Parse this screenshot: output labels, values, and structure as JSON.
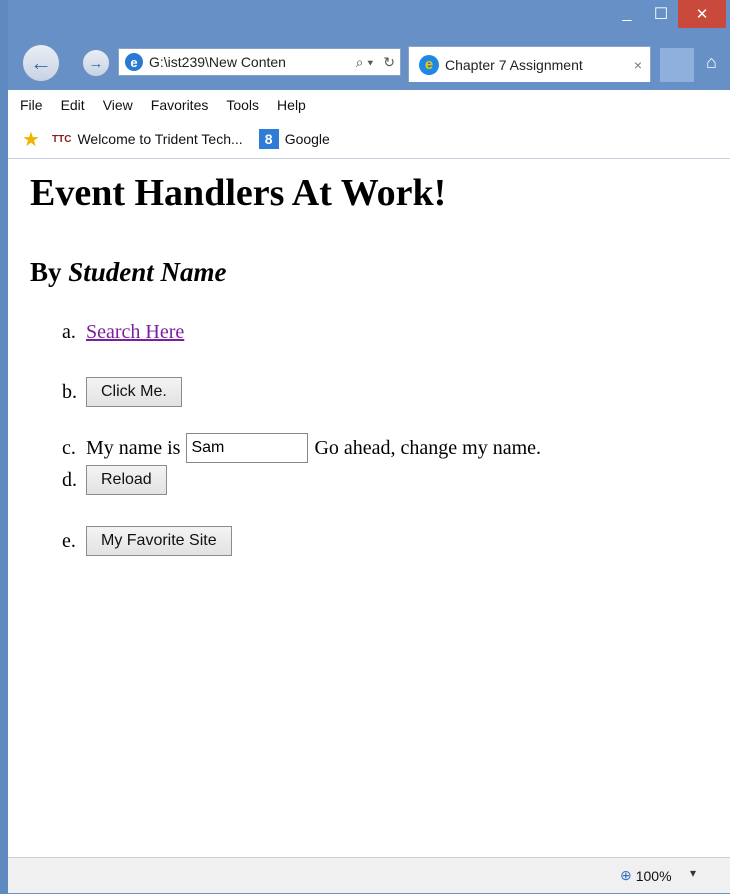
{
  "titlebar": {
    "min": "_",
    "max": "☐",
    "close": "✕"
  },
  "addressbar": {
    "url": "G:\\ist239\\New Conten",
    "search_glyph": "⌕ ▾",
    "refresh_glyph": "↻"
  },
  "tab": {
    "title": "Chapter 7 Assignment",
    "close": "×"
  },
  "menu": [
    "File",
    "Edit",
    "View",
    "Favorites",
    "Tools",
    "Help"
  ],
  "favorites": {
    "ttc_badge": "TTC",
    "link1": "Welcome to Trident Tech...",
    "google_badge": "8",
    "link2": "Google"
  },
  "page": {
    "heading": "Event Handlers At Work!",
    "subheading_by": "By ",
    "subheading_name": "Student Name",
    "items": [
      {
        "marker": "a.",
        "link_text": "Search Here"
      },
      {
        "marker": "b.",
        "button": "Click Me."
      },
      {
        "marker": "c.",
        "prefix": "My name is",
        "input_value": "Sam",
        "suffix": "Go ahead, change my name."
      },
      {
        "marker": "d.",
        "button": "Reload"
      },
      {
        "marker": "e.",
        "button": "My Favorite Site"
      }
    ]
  },
  "status": {
    "zoom": "100%",
    "zoom_arrow": "▾"
  }
}
